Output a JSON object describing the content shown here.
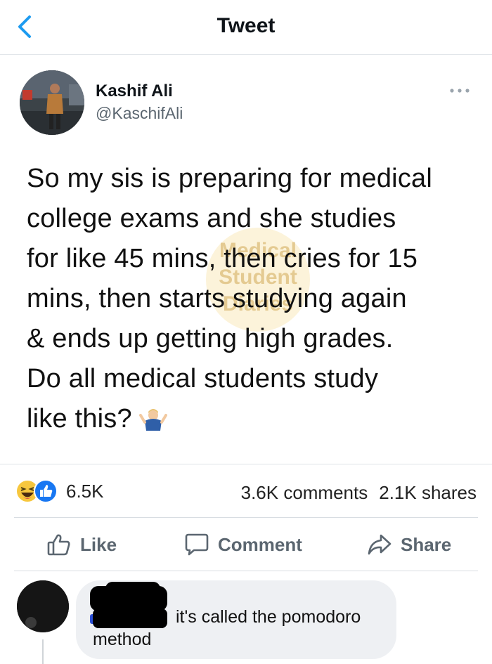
{
  "header": {
    "title": "Tweet"
  },
  "author": {
    "name": "Kashif Ali",
    "handle": "@KaschifAli"
  },
  "tweet": {
    "lines": [
      "So my sis is preparing for medical",
      "college exams and she studies",
      "for like 45 mins, then cries for 15",
      "mins, then starts studying again",
      "& ends up getting high grades.",
      "Do all medical students study",
      "like this?"
    ]
  },
  "watermark": {
    "lines": [
      "Medical",
      "Student",
      "Diaries"
    ]
  },
  "reactions": {
    "count": "6.5K",
    "icons": [
      "haha-icon",
      "like-icon"
    ]
  },
  "stats": {
    "comments": "3.6K comments",
    "shares": "2.1K shares"
  },
  "actions": {
    "like": "Like",
    "comment": "Comment",
    "share": "Share"
  },
  "comment": {
    "line1": "it's called the pomodoro",
    "line2": "method"
  },
  "colors": {
    "accent": "#1d9bf0",
    "like_blue": "#1877f2",
    "haha_yellow": "#f7c73e",
    "muted": "#5b6670"
  }
}
